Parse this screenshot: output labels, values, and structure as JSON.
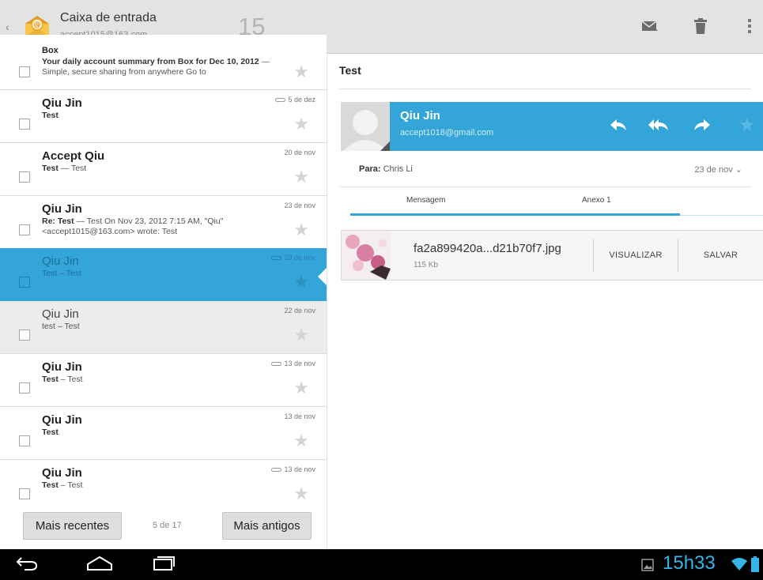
{
  "action_bar": {
    "title": "Caixa de entrada",
    "account": "accept1015@163.com",
    "unread_count": "15",
    "app_icon": "email-app-icon",
    "actions": [
      "mark-unread-icon",
      "trash-icon",
      "overflow-menu-icon"
    ]
  },
  "conversations": [
    {
      "sender": "Box",
      "subject": "Your daily account summary from Box for Dec 10, 2012",
      "snippet": " — Simple, secure sharing from anywhere Go to",
      "date": "",
      "attachment": false,
      "state": "unread"
    },
    {
      "sender": "Qiu Jin",
      "subject": "Test",
      "snippet": "",
      "date": "5 de dez",
      "attachment": true,
      "state": "unread"
    },
    {
      "sender": "Accept Qiu",
      "subject": "Test",
      "snippet": " — Test",
      "date": "20 de nov",
      "attachment": false,
      "state": "unread"
    },
    {
      "sender": "Qiu Jin",
      "subject": "Re: Test",
      "snippet": " — Test On Nov 23, 2012 7:15 AM, \"Qiu\" <accept1015@163.com> wrote: Test",
      "date": "23 de nov",
      "attachment": false,
      "state": "unread"
    },
    {
      "sender": "Qiu Jin",
      "subject": "Test",
      "snippet": " – Test",
      "date": "23 de nov",
      "attachment": true,
      "state": "selected"
    },
    {
      "sender": "Qiu Jin",
      "subject": "test",
      "snippet": " – Test",
      "date": "22 de nov",
      "attachment": false,
      "state": "read"
    },
    {
      "sender": "Qiu Jin",
      "subject": "Test",
      "snippet": " – Test",
      "date": "13 de nov",
      "attachment": true,
      "state": "unread"
    },
    {
      "sender": "Qiu Jin",
      "subject": "Test",
      "snippet": "",
      "date": "13 de nov",
      "attachment": false,
      "state": "unread"
    },
    {
      "sender": "Qiu Jin",
      "subject": "Test",
      "snippet": " – Test",
      "date": "13 de nov",
      "attachment": true,
      "state": "unread"
    }
  ],
  "pagination": {
    "newer_label": "Mais recentes",
    "position": "5 de 17",
    "older_label": "Mais antigos"
  },
  "message": {
    "subject": "Test",
    "sender_name": "Qiu Jin",
    "sender_email": "accept1018@gmail.com",
    "to_label": "Para:",
    "to_value": "Chris Li",
    "date": "23 de nov",
    "tabs": [
      "Mensagem",
      "Anexo 1"
    ],
    "active_tab": "Anexo 1",
    "header_actions": [
      "reply-icon",
      "reply-all-icon",
      "forward-icon",
      "star-icon"
    ],
    "attachment": {
      "filename": "fa2a899420a...d21b70f7.jpg",
      "size": "115 Kb",
      "view_label": "VISUALIZAR",
      "save_label": "SALVAR"
    }
  },
  "system_bar": {
    "time": "15h33",
    "icons": [
      "back-icon",
      "home-icon",
      "recent-apps-icon",
      "gallery-notification-icon",
      "wifi-icon",
      "battery-icon"
    ]
  },
  "colors": {
    "accent": "#33a5d9",
    "action_bar": "#e3e3e3",
    "system_bar": "#000000",
    "clock": "#36b4e8"
  }
}
